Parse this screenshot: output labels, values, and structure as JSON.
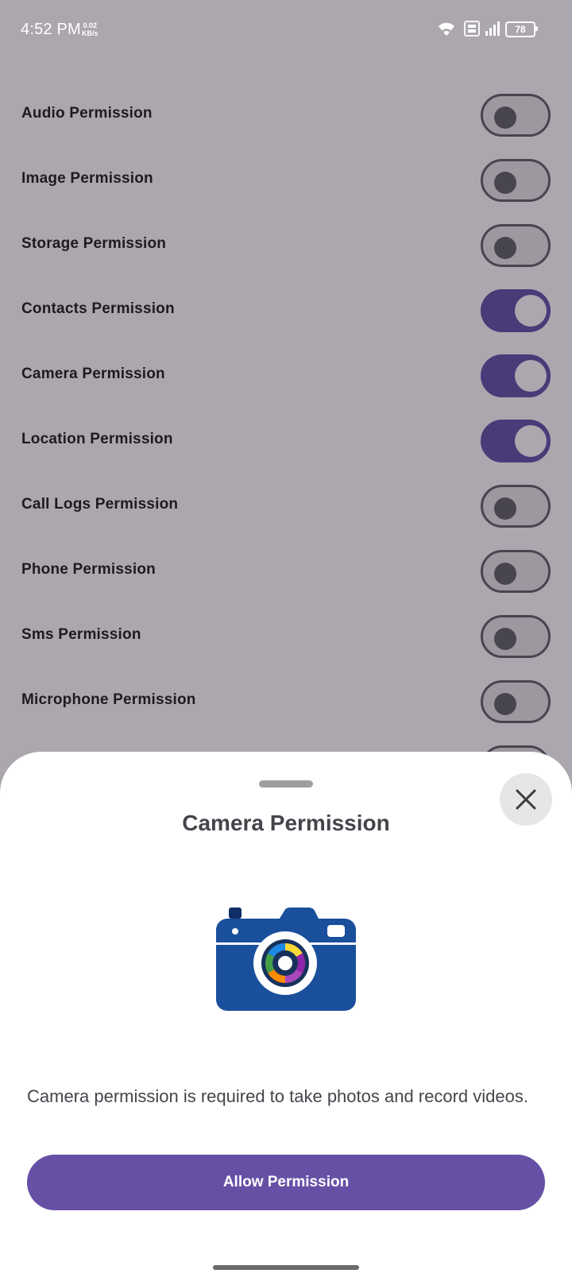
{
  "status_bar": {
    "time": "4:52 PM",
    "net_speed_value": "0.02",
    "net_speed_unit": "KB/s",
    "battery": "78",
    "icons": [
      "wifi-icon",
      "volte-icon",
      "signal-icon",
      "battery-icon"
    ]
  },
  "permissions": [
    {
      "label": "Audio Permission",
      "enabled": false
    },
    {
      "label": "Image Permission",
      "enabled": false
    },
    {
      "label": "Storage Permission",
      "enabled": false
    },
    {
      "label": "Contacts Permission",
      "enabled": true
    },
    {
      "label": "Camera Permission",
      "enabled": true
    },
    {
      "label": "Location Permission",
      "enabled": true
    },
    {
      "label": "Call Logs Permission",
      "enabled": false
    },
    {
      "label": "Phone Permission",
      "enabled": false
    },
    {
      "label": "Sms Permission",
      "enabled": false
    },
    {
      "label": "Microphone Permission",
      "enabled": false
    }
  ],
  "sheet": {
    "title": "Camera Permission",
    "illustration": "camera-icon",
    "description": "Camera permission is required to take photos and record videos.",
    "button_label": "Allow Permission",
    "close_icon": "close-icon"
  },
  "colors": {
    "accent": "#6650a6",
    "toggle_on": "#4a3a78",
    "camera_blue": "#1a4f9c",
    "scrim": "#aca7ae"
  }
}
